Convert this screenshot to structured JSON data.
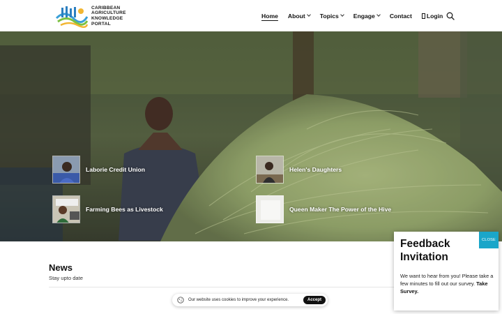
{
  "brand": {
    "logo_lines": [
      "CARIBBEAN",
      "AGRICULTURE",
      "KNOWLEDGE",
      "PORTAL"
    ]
  },
  "nav": {
    "home": "Home",
    "about": "About",
    "topics": "Topics",
    "engage": "Engage",
    "contact": "Contact",
    "login": "Login",
    "icons": {
      "login": "login-icon",
      "search": "search-icon"
    }
  },
  "hero": {
    "cards": [
      {
        "title": "Laborie Credit Union"
      },
      {
        "title": "Helen's Daughters"
      },
      {
        "title": "Farming Bees as Livestock"
      },
      {
        "title": "Queen Maker The Power of the Hive"
      }
    ]
  },
  "news": {
    "title": "News",
    "subtitle": "Stay upto date"
  },
  "cookie": {
    "text": "Our website uses cookies to improve your experience.",
    "accept": "Accept"
  },
  "feedback": {
    "close": "CLOSE",
    "title": "Feedback Invitation",
    "body": "We want to hear from you! Please take a few minutes to fill out our survey.",
    "link": "Take Survey."
  },
  "colors": {
    "accent": "#1aa6c9"
  }
}
